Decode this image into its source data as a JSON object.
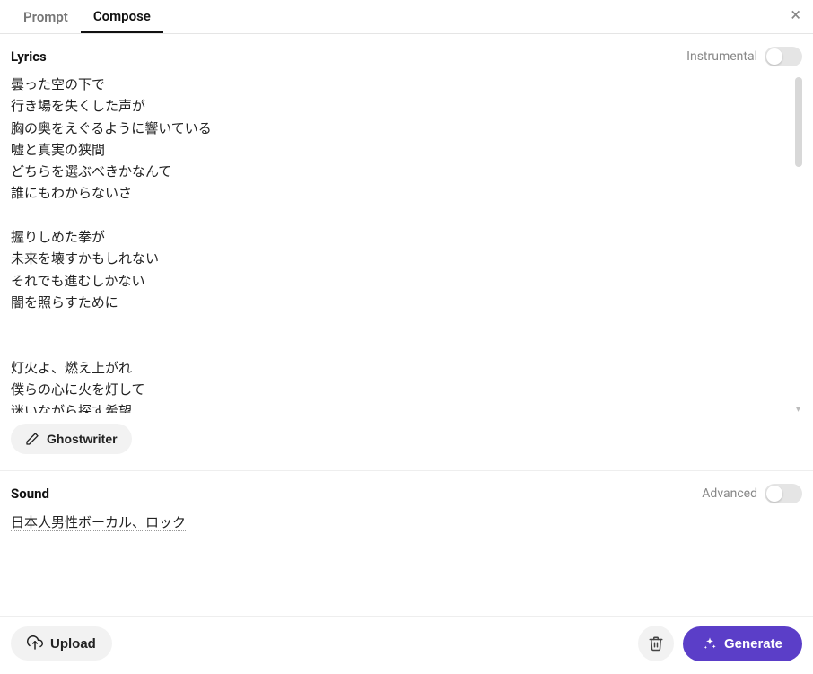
{
  "tabs": {
    "prompt": "Prompt",
    "compose": "Compose"
  },
  "close_label": "×",
  "lyrics": {
    "title": "Lyrics",
    "instrumental_label": "Instrumental",
    "instrumental_on": false,
    "content": "曇った空の下で\n行き場を失くした声が\n胸の奥をえぐるように響いている\n嘘と真実の狭間\nどちらを選ぶべきかなんて\n誰にもわからないさ\n\n握りしめた拳が\n未来を壊すかもしれない\nそれでも進むしかない\n闇を照らすために\n\n\n灯火よ、燃え上がれ\n僕らの心に火を灯して\n迷いながら探す希望",
    "ghostwriter_label": "Ghostwriter"
  },
  "sound": {
    "title": "Sound",
    "advanced_label": "Advanced",
    "advanced_on": false,
    "content": "日本人男性ボーカル、ロック"
  },
  "footer": {
    "upload_label": "Upload",
    "generate_label": "Generate"
  },
  "colors": {
    "accent": "#5b3ec8"
  }
}
